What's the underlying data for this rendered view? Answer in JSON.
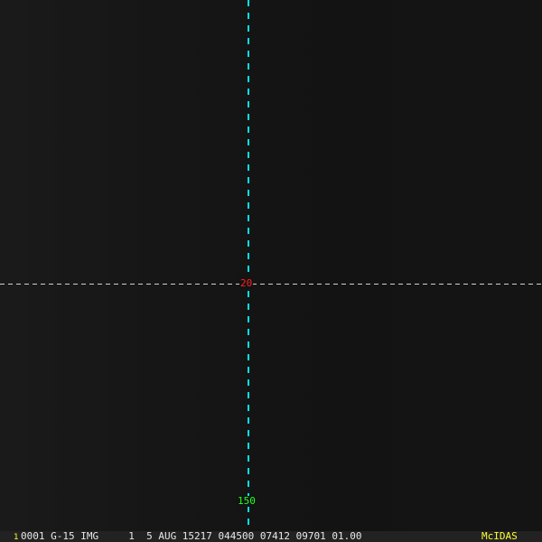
{
  "overlay": {
    "latitude_label": "20",
    "longitude_label": "150",
    "colors": {
      "lat_line": "#d0d0d0",
      "lon_line": "#00e0e8",
      "lat_label": "#ff2020",
      "lon_label": "#20ff20"
    }
  },
  "status_bar": {
    "frame_number": "1",
    "info": "0001 G-15 IMG     1  5 AUG 15217 044500 07412 09701 01.00",
    "brand": "McIDAS"
  }
}
